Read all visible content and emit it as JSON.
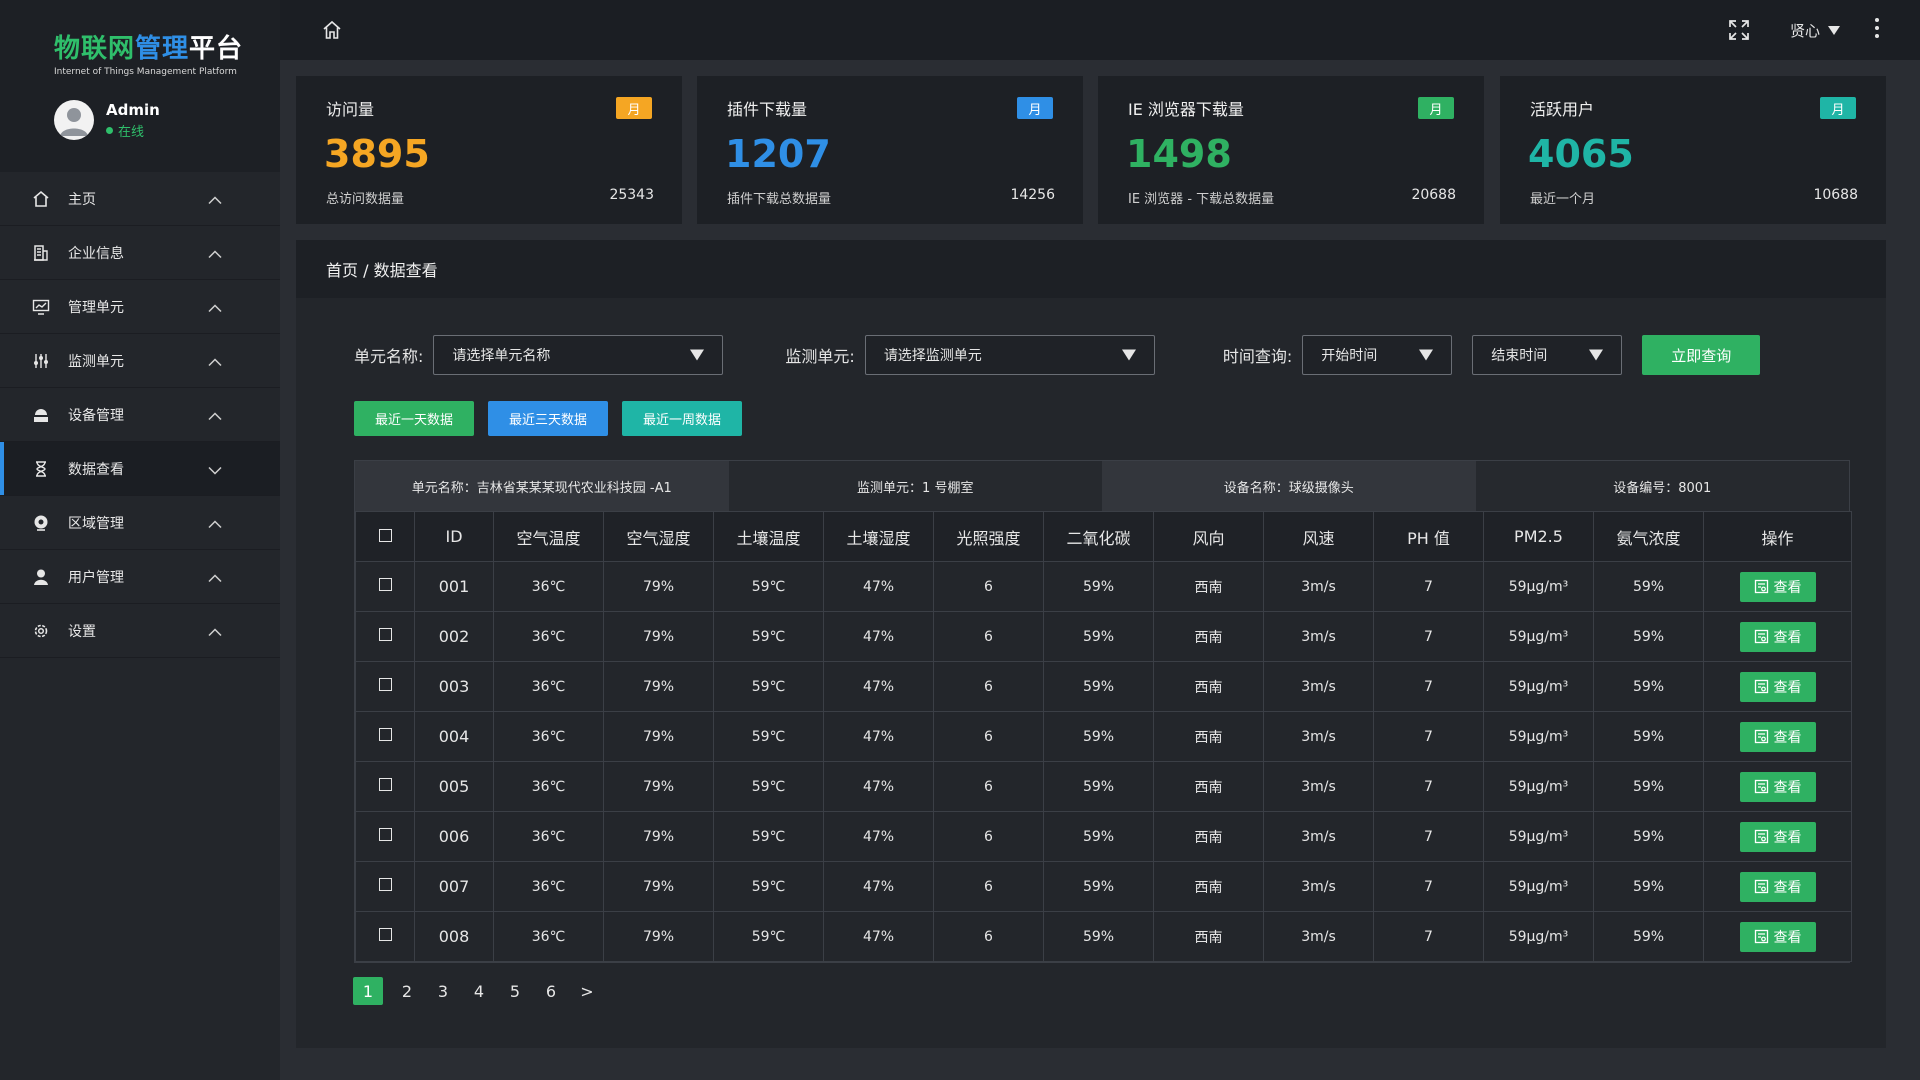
{
  "logo": {
    "title_part1": "物联网",
    "title_part2": "管理",
    "title_part3": "平台",
    "subtitle": "Internet of Things Management Platform"
  },
  "user": {
    "name": "Admin",
    "status": "在线"
  },
  "sidebar": {
    "items": [
      {
        "label": "主页",
        "icon": "home-icon"
      },
      {
        "label": "企业信息",
        "icon": "building-icon"
      },
      {
        "label": "管理单元",
        "icon": "chart-monitor-icon"
      },
      {
        "label": "监测单元",
        "icon": "sliders-icon"
      },
      {
        "label": "设备管理",
        "icon": "device-icon"
      },
      {
        "label": "数据查看",
        "icon": "hourglass-icon"
      },
      {
        "label": "区域管理",
        "icon": "location-icon"
      },
      {
        "label": "用户管理",
        "icon": "user-icon"
      },
      {
        "label": "设置",
        "icon": "gear-icon"
      }
    ]
  },
  "topbar": {
    "user_menu": "贤心"
  },
  "cards": [
    {
      "title": "访问量",
      "badge": "月",
      "value": "3895",
      "desc": "总访问数据量",
      "total": "25343",
      "color": "#f5a623"
    },
    {
      "title": "插件下载量",
      "badge": "月",
      "value": "1207",
      "desc": "插件下载总数据量",
      "total": "14256",
      "color": "#2f8fe6"
    },
    {
      "title": "IE 浏览器下载量",
      "badge": "月",
      "value": "1498",
      "desc": "IE 浏览器 - 下载总数据量",
      "total": "20688",
      "color": "#2fb162"
    },
    {
      "title": "活跃用户",
      "badge": "月",
      "value": "4065",
      "desc": "最近一个月",
      "total": "10688",
      "color": "#1fb5a6"
    }
  ],
  "breadcrumb": "首页 / 数据查看",
  "filters": {
    "unit_label": "单元名称:",
    "unit_placeholder": "请选择单元名称",
    "monitor_label": "监测单元:",
    "monitor_placeholder": "请选择监测单元",
    "time_label": "时间查询:",
    "start": "开始时间",
    "end": "结束时间",
    "query_button": "立即查询"
  },
  "quick": {
    "day": "最近一天数据",
    "three": "最近三天数据",
    "week": "最近一周数据"
  },
  "info": {
    "unit": "单元名称：吉林省某某某现代农业科技园 -A1",
    "monitor": "监测单元：1 号棚室",
    "device": "设备名称：球级摄像头",
    "code": "设备编号：8001"
  },
  "table": {
    "headers": [
      "ID",
      "空气温度",
      "空气湿度",
      "土壤温度",
      "土壤湿度",
      "光照强度",
      "二氧化碳",
      "风向",
      "风速",
      "PH 值",
      "PM2.5",
      "氨气浓度",
      "操作"
    ],
    "view_label": "查看",
    "rows": [
      [
        "001",
        "36℃",
        "79%",
        "59℃",
        "47%",
        "6",
        "59%",
        "西南",
        "3m/s",
        "7",
        "59μg/m³",
        "59%"
      ],
      [
        "002",
        "36℃",
        "79%",
        "59℃",
        "47%",
        "6",
        "59%",
        "西南",
        "3m/s",
        "7",
        "59μg/m³",
        "59%"
      ],
      [
        "003",
        "36℃",
        "79%",
        "59℃",
        "47%",
        "6",
        "59%",
        "西南",
        "3m/s",
        "7",
        "59μg/m³",
        "59%"
      ],
      [
        "004",
        "36℃",
        "79%",
        "59℃",
        "47%",
        "6",
        "59%",
        "西南",
        "3m/s",
        "7",
        "59μg/m³",
        "59%"
      ],
      [
        "005",
        "36℃",
        "79%",
        "59℃",
        "47%",
        "6",
        "59%",
        "西南",
        "3m/s",
        "7",
        "59μg/m³",
        "59%"
      ],
      [
        "006",
        "36℃",
        "79%",
        "59℃",
        "47%",
        "6",
        "59%",
        "西南",
        "3m/s",
        "7",
        "59μg/m³",
        "59%"
      ],
      [
        "007",
        "36℃",
        "79%",
        "59℃",
        "47%",
        "6",
        "59%",
        "西南",
        "3m/s",
        "7",
        "59μg/m³",
        "59%"
      ],
      [
        "008",
        "36℃",
        "79%",
        "59℃",
        "47%",
        "6",
        "59%",
        "西南",
        "3m/s",
        "7",
        "59μg/m³",
        "59%"
      ]
    ]
  },
  "pagination": {
    "pages": [
      "1",
      "2",
      "3",
      "4",
      "5",
      "6"
    ],
    "next": ">",
    "active": "1"
  },
  "colors": {
    "green": "#2fb162",
    "blue": "#2f8fe6",
    "teal": "#1fb5a6",
    "orange": "#f5a623"
  }
}
